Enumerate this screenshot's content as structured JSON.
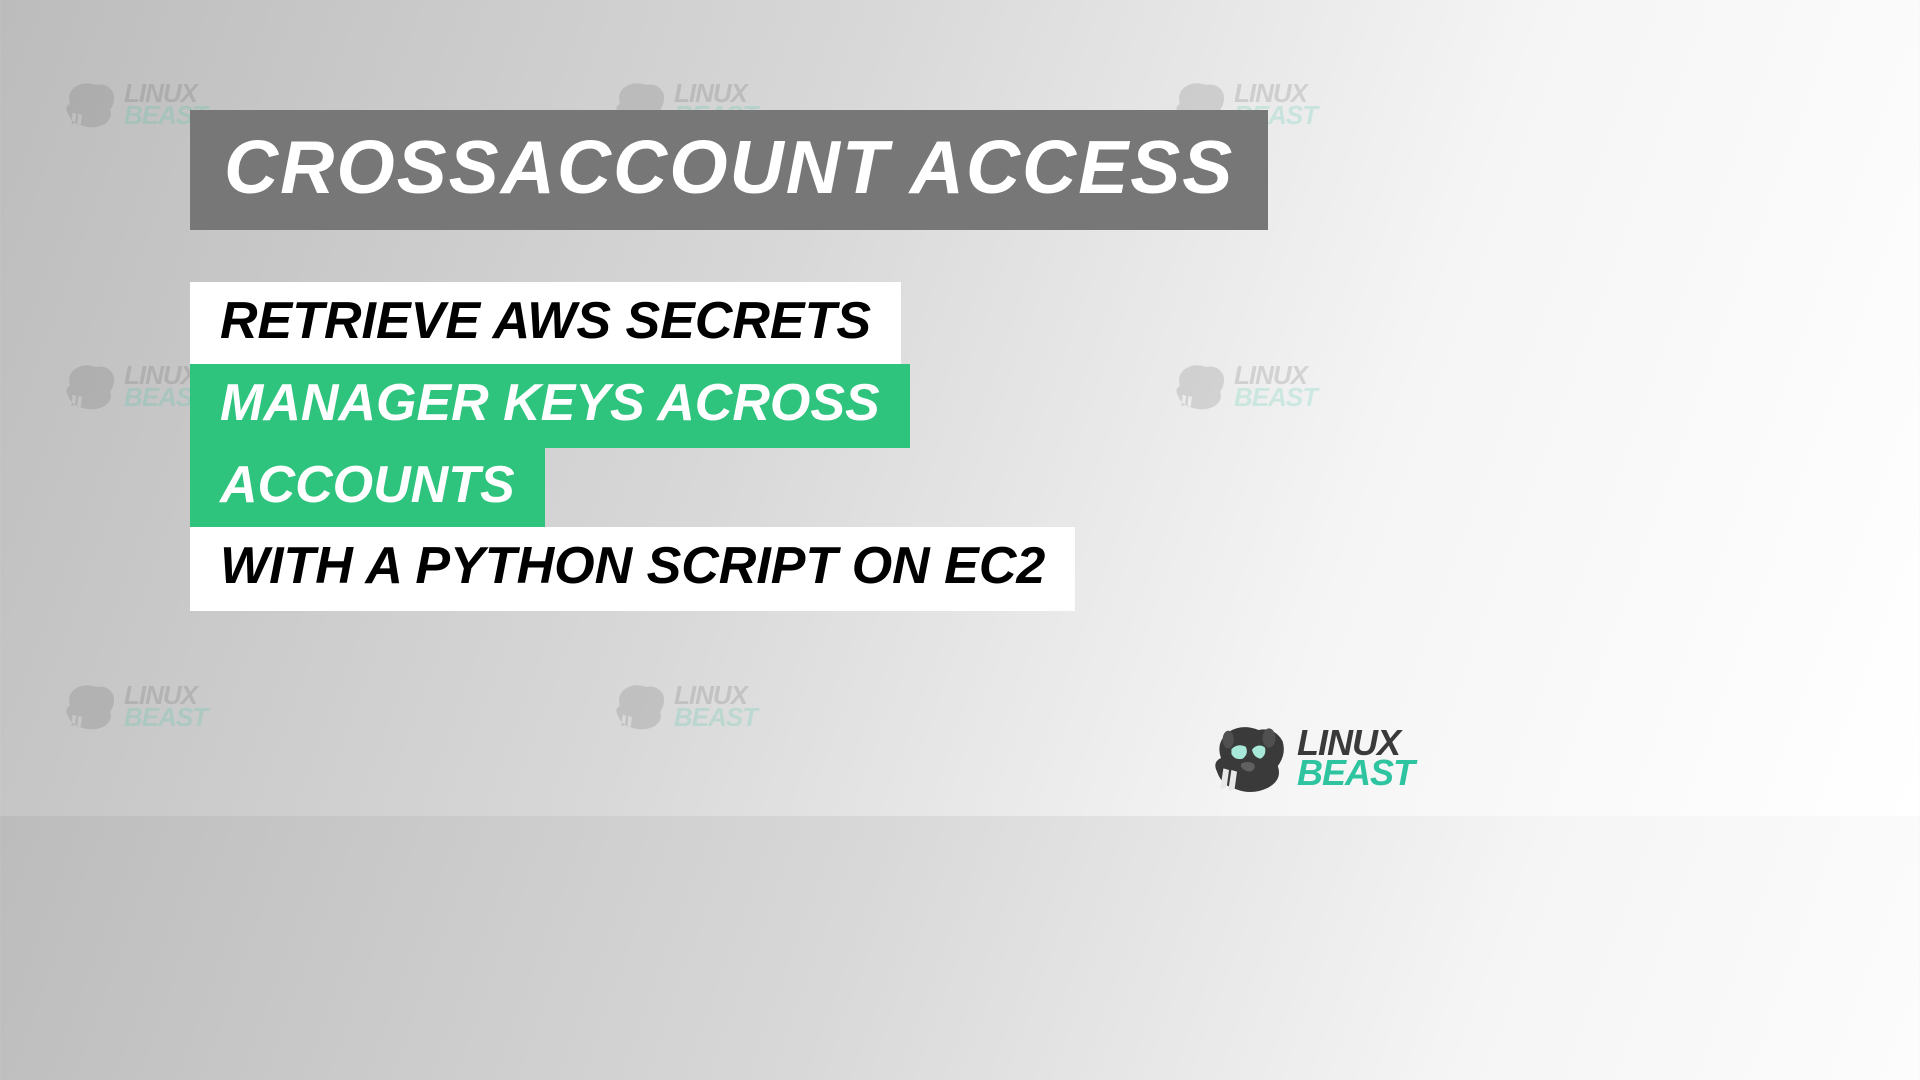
{
  "title": "CROSSACCOUNT ACCESS",
  "lines": {
    "l1": "RETRIEVE AWS SECRETS",
    "l2": "MANAGER KEYS ACROSS",
    "l3": "ACCOUNTS",
    "l4": "WITH A PYTHON SCRIPT ON EC2"
  },
  "brand": {
    "linux": "LINUX",
    "beast": "BEAST"
  },
  "colors": {
    "titleBg": "#777777",
    "highlightBg": "#2ec47e",
    "brandTeal": "#2ec4a0"
  }
}
